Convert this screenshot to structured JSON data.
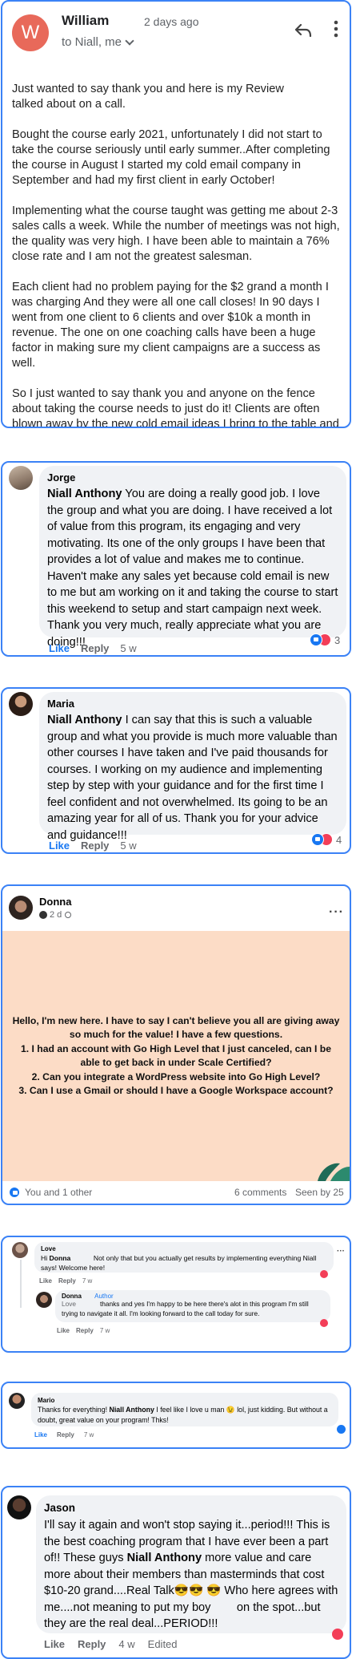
{
  "email": {
    "sender_initial": "W",
    "sender": "William",
    "time": "2 days ago",
    "to": "to Niall, me",
    "paragraphs": [
      "Just wanted to say thank you and here is my Review\n              talked about on a call.",
      "Bought the course early 2021, unfortunately I did not start to take the course seriously until early summer..After completing the course in August I started my cold email company in September and had my first client in early October!",
      "Implementing what the course taught was getting me about 2-3 sales calls a week. While the number of meetings was not high, the quality was very high. I have been able to maintain a 76% close rate and I am not the greatest salesman.",
      "Each client had no problem paying for the $2 grand a month I was charging And they were all one call closes! In 90 days I went from one client to 6 clients and over $10k a month in revenue. The one on one coaching calls have been a huge factor in making sure my client campaigns are a success as well.",
      "So I just wanted to say thank you and anyone on the fence about taking the course needs to just do it! Clients are often blown away by the new cold email ideas I bring to the table and these have all been very easy to close."
    ],
    "colors": {
      "avatar": "#e8695a",
      "link_border": "#3b82f6"
    }
  },
  "jorge": {
    "name": "Jorge",
    "mention": "Niall Anthony",
    "text": " You are doing a really good job. I love the group and what you are doing. I have received a lot of value from this program, its engaging and very motivating. Its one of the only groups I have been that provides a lot of value and makes me to continue. Haven't make any sales yet because cold email is new to me but am working on it and taking the course to start this weekend to setup and start campaign next week. Thank you very much, really appreciate what you are doing!!!",
    "like": "Like",
    "reply": "Reply",
    "time": "5 w",
    "reactions": "3"
  },
  "maria": {
    "name": "Maria",
    "mention": "Niall Anthony",
    "text": " I can say that this is such a valuable group and what you provide is much more valuable than other courses I have taken and I've paid thousands for courses. I working on my audience and implementing step by step with your guidance and for the first time I feel confident and not overwhelmed. Its going to be an amazing year for all of us. Thank you for your advice and guidance!!!",
    "like": "Like",
    "reply": "Reply",
    "time": "5 w",
    "reactions": "4"
  },
  "donna_post": {
    "name": "Donna",
    "meta": "2 d",
    "body": "Hello, I'm new here. I have to say I can't believe you all are giving away so much for the value! I have a few questions.\n1. I had an account with Go High Level that I just canceled, can I be able to get back in under Scale Certified?\n2. Can you integrate a WordPress website into Go High Level?\n3. Can I use a Gmail or should I have a Google Workspace account?",
    "reactions_text": "You and 1 other",
    "comments": "6 comments",
    "seen": "Seen by 25",
    "colors": {
      "background": "#fcdcc6"
    }
  },
  "love_thread": {
    "love_name": "Love",
    "love_text_pre": "Hi ",
    "love_mention": "Donna",
    "love_text": "            Not only that but you actually get results by implementing everything Niall says! Welcome here!",
    "love_like": "Like",
    "love_reply": "Reply",
    "love_time": "7 w",
    "donna_name": "Donna",
    "donna_badge": "Author",
    "donna_pre": "Love",
    "donna_text": "             thanks and yes I'm happy to be here there's alot in this program I'm still trying to navigate it all. I'm looking forward to the call today for sure.",
    "donna_like": "Like",
    "donna_reply": "Reply",
    "donna_time": "7 w"
  },
  "mario": {
    "name": "Mario",
    "text_pre": "Thanks for everything! ",
    "mention": "Niall Anthony",
    "text": " I feel like I love u man 😉 lol, just kidding. But without a doubt, great value on your program! Thks!",
    "like": "Like",
    "reply": "Reply",
    "time": "7 w"
  },
  "jason": {
    "name": "Jason",
    "text_pre": "I'll say it again and won't stop saying it...period!!! This is the best coaching program that I have ever been a part of!! These guys ",
    "mention": "Niall Anthony",
    "text": " more value and care more about their members than masterminds that cost $10-20 grand....Real Talk😎😎 😎 Who here agrees with me....not meaning to put my boy        on the spot...but they are the real deal...PERIOD!!!",
    "like": "Like",
    "reply": "Reply",
    "time": "4 w",
    "edited": "Edited"
  }
}
